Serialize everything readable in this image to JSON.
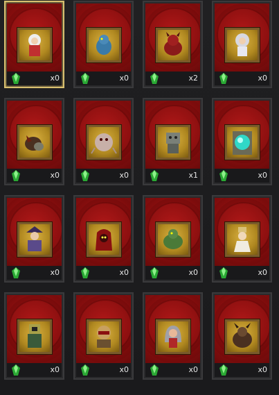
{
  "cards": [
    {
      "portrait": "white-haired-swordswoman-portrait-icon",
      "count": "x0",
      "selected": true
    },
    {
      "portrait": "blue-dragon-portrait-icon",
      "count": "x0"
    },
    {
      "portrait": "red-demon-beast-portrait-icon",
      "count": "x2"
    },
    {
      "portrait": "silver-haired-mage-portrait-icon",
      "count": "x0"
    },
    {
      "portrait": "dark-insect-beast-portrait-icon",
      "count": "x0"
    },
    {
      "portrait": "pale-spider-creature-portrait-icon",
      "count": "x0"
    },
    {
      "portrait": "stone-gargoyle-portrait-icon",
      "count": "x1"
    },
    {
      "portrait": "cyan-orb-shrine-portrait-icon",
      "count": "x0"
    },
    {
      "portrait": "purple-armored-knight-portrait-icon",
      "count": "x0"
    },
    {
      "portrait": "crimson-hooded-demon-portrait-icon",
      "count": "x0"
    },
    {
      "portrait": "green-lizard-warrior-portrait-icon",
      "count": "x0"
    },
    {
      "portrait": "white-robed-sage-portrait-icon",
      "count": "x0"
    },
    {
      "portrait": "green-armored-guardian-portrait-icon",
      "count": "x0"
    },
    {
      "portrait": "masked-warlord-portrait-icon",
      "count": "x0"
    },
    {
      "portrait": "grey-haired-sorceress-portrait-icon",
      "count": "x0"
    },
    {
      "portrait": "horned-dark-brute-portrait-icon",
      "count": "x0"
    }
  ],
  "colors": {
    "card_red": "#9a1414",
    "selected_border": "#d8c070",
    "gem_green": "#36c040",
    "portrait_gold": "#c49a2a"
  }
}
